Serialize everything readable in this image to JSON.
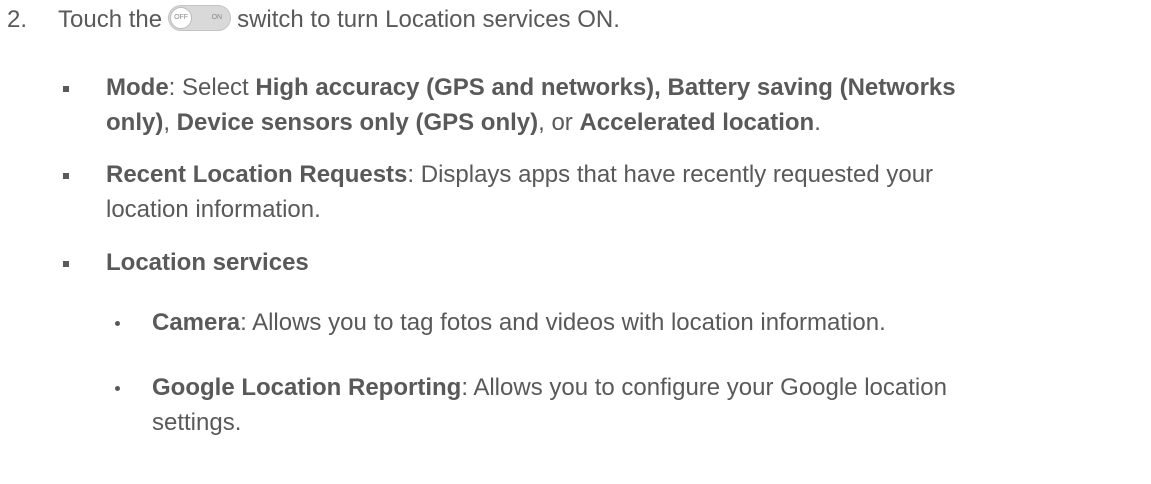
{
  "step": {
    "number": "2.",
    "before": "Touch the",
    "switch_off": "OFF",
    "switch_on": "ON",
    "after": "switch to turn Location services ON."
  },
  "mode": {
    "term": "Mode",
    "colon_select": ": Select ",
    "opt1": "High accuracy (GPS and networks), Battery saving (Networks",
    "opt1b": "only)",
    "sep1": ", ",
    "opt2": "Device sensors only (GPS only)",
    "sep2": ", or ",
    "opt3": "Accelerated location",
    "end": "."
  },
  "recent": {
    "term": "Recent Location Requests",
    "desc1": ": Displays apps that have recently requested your",
    "desc2": "location information."
  },
  "services": {
    "term": "Location services"
  },
  "camera": {
    "term": "Camera",
    "desc": ": Allows you to tag fotos and videos with location information."
  },
  "google": {
    "term": "Google Location Reporting",
    "desc1": ": Allows you to configure your Google location",
    "desc2": "settings."
  }
}
